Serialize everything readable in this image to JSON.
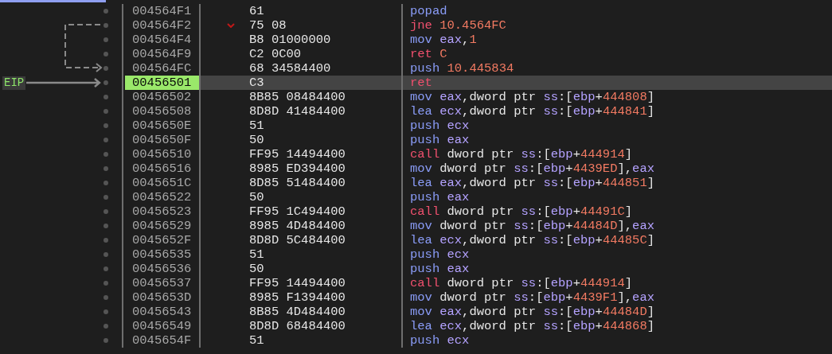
{
  "eip_label": "EIP",
  "rows": [
    {
      "address": "004564F1",
      "bytes": "61",
      "selected": false,
      "branch_marker": false,
      "instruction": {
        "mnemonic": {
          "text": "popad",
          "kind": "normal"
        }
      }
    },
    {
      "address": "004564F2",
      "bytes": "75 08",
      "selected": false,
      "branch_marker": true,
      "instruction": {
        "mnemonic": {
          "text": "jne",
          "kind": "branch"
        },
        "operands": [
          {
            "text": "10.4564FC",
            "kind": "number"
          }
        ]
      }
    },
    {
      "address": "004564F4",
      "bytes": "B8 01000000",
      "selected": false,
      "branch_marker": false,
      "instruction": {
        "mnemonic": {
          "text": "mov",
          "kind": "normal"
        },
        "operands": [
          {
            "text": "eax",
            "kind": "register"
          },
          {
            "text": ",",
            "kind": "plain"
          },
          {
            "text": "1",
            "kind": "number"
          }
        ]
      }
    },
    {
      "address": "004564F9",
      "bytes": "C2 0C00",
      "selected": false,
      "branch_marker": false,
      "instruction": {
        "mnemonic": {
          "text": "ret",
          "kind": "branch"
        },
        "operands": [
          {
            "text": "C",
            "kind": "number"
          }
        ]
      }
    },
    {
      "address": "004564FC",
      "bytes": "68 34584400",
      "selected": false,
      "branch_marker": false,
      "instruction": {
        "mnemonic": {
          "text": "push",
          "kind": "normal"
        },
        "operands": [
          {
            "text": "10.445834",
            "kind": "number"
          }
        ]
      }
    },
    {
      "address": "00456501",
      "bytes": "C3",
      "selected": true,
      "branch_marker": false,
      "instruction": {
        "mnemonic": {
          "text": "ret",
          "kind": "branch"
        }
      }
    },
    {
      "address": "00456502",
      "bytes": "8B85 08484400",
      "selected": false,
      "branch_marker": false,
      "instruction": {
        "mnemonic": {
          "text": "mov",
          "kind": "normal"
        },
        "operands": [
          {
            "text": "eax",
            "kind": "register"
          },
          {
            "text": ",dword ptr ",
            "kind": "plain"
          },
          {
            "text": "ss",
            "kind": "register"
          },
          {
            "text": ":[",
            "kind": "plain"
          },
          {
            "text": "ebp",
            "kind": "register"
          },
          {
            "text": "+",
            "kind": "plain"
          },
          {
            "text": "444808",
            "kind": "number"
          },
          {
            "text": "]",
            "kind": "plain"
          }
        ]
      }
    },
    {
      "address": "00456508",
      "bytes": "8D8D 41484400",
      "selected": false,
      "branch_marker": false,
      "instruction": {
        "mnemonic": {
          "text": "lea",
          "kind": "normal"
        },
        "operands": [
          {
            "text": "ecx",
            "kind": "register"
          },
          {
            "text": ",dword ptr ",
            "kind": "plain"
          },
          {
            "text": "ss",
            "kind": "register"
          },
          {
            "text": ":[",
            "kind": "plain"
          },
          {
            "text": "ebp",
            "kind": "register"
          },
          {
            "text": "+",
            "kind": "plain"
          },
          {
            "text": "444841",
            "kind": "number"
          },
          {
            "text": "]",
            "kind": "plain"
          }
        ]
      }
    },
    {
      "address": "0045650E",
      "bytes": "51",
      "selected": false,
      "branch_marker": false,
      "instruction": {
        "mnemonic": {
          "text": "push",
          "kind": "normal"
        },
        "operands": [
          {
            "text": "ecx",
            "kind": "register"
          }
        ]
      }
    },
    {
      "address": "0045650F",
      "bytes": "50",
      "selected": false,
      "branch_marker": false,
      "instruction": {
        "mnemonic": {
          "text": "push",
          "kind": "normal"
        },
        "operands": [
          {
            "text": "eax",
            "kind": "register"
          }
        ]
      }
    },
    {
      "address": "00456510",
      "bytes": "FF95 14494400",
      "selected": false,
      "branch_marker": false,
      "instruction": {
        "mnemonic": {
          "text": "call",
          "kind": "branch"
        },
        "operands": [
          {
            "text": "dword ptr ",
            "kind": "plain"
          },
          {
            "text": "ss",
            "kind": "register"
          },
          {
            "text": ":[",
            "kind": "plain"
          },
          {
            "text": "ebp",
            "kind": "register"
          },
          {
            "text": "+",
            "kind": "plain"
          },
          {
            "text": "444914",
            "kind": "number"
          },
          {
            "text": "]",
            "kind": "plain"
          }
        ]
      }
    },
    {
      "address": "00456516",
      "bytes": "8985 ED394400",
      "selected": false,
      "branch_marker": false,
      "instruction": {
        "mnemonic": {
          "text": "mov",
          "kind": "normal"
        },
        "operands": [
          {
            "text": "dword ptr ",
            "kind": "plain"
          },
          {
            "text": "ss",
            "kind": "register"
          },
          {
            "text": ":[",
            "kind": "plain"
          },
          {
            "text": "ebp",
            "kind": "register"
          },
          {
            "text": "+",
            "kind": "plain"
          },
          {
            "text": "4439ED",
            "kind": "number"
          },
          {
            "text": "],",
            "kind": "plain"
          },
          {
            "text": "eax",
            "kind": "register"
          }
        ]
      }
    },
    {
      "address": "0045651C",
      "bytes": "8D85 51484400",
      "selected": false,
      "branch_marker": false,
      "instruction": {
        "mnemonic": {
          "text": "lea",
          "kind": "normal"
        },
        "operands": [
          {
            "text": "eax",
            "kind": "register"
          },
          {
            "text": ",dword ptr ",
            "kind": "plain"
          },
          {
            "text": "ss",
            "kind": "register"
          },
          {
            "text": ":[",
            "kind": "plain"
          },
          {
            "text": "ebp",
            "kind": "register"
          },
          {
            "text": "+",
            "kind": "plain"
          },
          {
            "text": "444851",
            "kind": "number"
          },
          {
            "text": "]",
            "kind": "plain"
          }
        ]
      }
    },
    {
      "address": "00456522",
      "bytes": "50",
      "selected": false,
      "branch_marker": false,
      "instruction": {
        "mnemonic": {
          "text": "push",
          "kind": "normal"
        },
        "operands": [
          {
            "text": "eax",
            "kind": "register"
          }
        ]
      }
    },
    {
      "address": "00456523",
      "bytes": "FF95 1C494400",
      "selected": false,
      "branch_marker": false,
      "instruction": {
        "mnemonic": {
          "text": "call",
          "kind": "branch"
        },
        "operands": [
          {
            "text": "dword ptr ",
            "kind": "plain"
          },
          {
            "text": "ss",
            "kind": "register"
          },
          {
            "text": ":[",
            "kind": "plain"
          },
          {
            "text": "ebp",
            "kind": "register"
          },
          {
            "text": "+",
            "kind": "plain"
          },
          {
            "text": "44491C",
            "kind": "number"
          },
          {
            "text": "]",
            "kind": "plain"
          }
        ]
      }
    },
    {
      "address": "00456529",
      "bytes": "8985 4D484400",
      "selected": false,
      "branch_marker": false,
      "instruction": {
        "mnemonic": {
          "text": "mov",
          "kind": "normal"
        },
        "operands": [
          {
            "text": "dword ptr ",
            "kind": "plain"
          },
          {
            "text": "ss",
            "kind": "register"
          },
          {
            "text": ":[",
            "kind": "plain"
          },
          {
            "text": "ebp",
            "kind": "register"
          },
          {
            "text": "+",
            "kind": "plain"
          },
          {
            "text": "44484D",
            "kind": "number"
          },
          {
            "text": "],",
            "kind": "plain"
          },
          {
            "text": "eax",
            "kind": "register"
          }
        ]
      }
    },
    {
      "address": "0045652F",
      "bytes": "8D8D 5C484400",
      "selected": false,
      "branch_marker": false,
      "instruction": {
        "mnemonic": {
          "text": "lea",
          "kind": "normal"
        },
        "operands": [
          {
            "text": "ecx",
            "kind": "register"
          },
          {
            "text": ",dword ptr ",
            "kind": "plain"
          },
          {
            "text": "ss",
            "kind": "register"
          },
          {
            "text": ":[",
            "kind": "plain"
          },
          {
            "text": "ebp",
            "kind": "register"
          },
          {
            "text": "+",
            "kind": "plain"
          },
          {
            "text": "44485C",
            "kind": "number"
          },
          {
            "text": "]",
            "kind": "plain"
          }
        ]
      }
    },
    {
      "address": "00456535",
      "bytes": "51",
      "selected": false,
      "branch_marker": false,
      "instruction": {
        "mnemonic": {
          "text": "push",
          "kind": "normal"
        },
        "operands": [
          {
            "text": "ecx",
            "kind": "register"
          }
        ]
      }
    },
    {
      "address": "00456536",
      "bytes": "50",
      "selected": false,
      "branch_marker": false,
      "instruction": {
        "mnemonic": {
          "text": "push",
          "kind": "normal"
        },
        "operands": [
          {
            "text": "eax",
            "kind": "register"
          }
        ]
      }
    },
    {
      "address": "00456537",
      "bytes": "FF95 14494400",
      "selected": false,
      "branch_marker": false,
      "instruction": {
        "mnemonic": {
          "text": "call",
          "kind": "branch"
        },
        "operands": [
          {
            "text": "dword ptr ",
            "kind": "plain"
          },
          {
            "text": "ss",
            "kind": "register"
          },
          {
            "text": ":[",
            "kind": "plain"
          },
          {
            "text": "ebp",
            "kind": "register"
          },
          {
            "text": "+",
            "kind": "plain"
          },
          {
            "text": "444914",
            "kind": "number"
          },
          {
            "text": "]",
            "kind": "plain"
          }
        ]
      }
    },
    {
      "address": "0045653D",
      "bytes": "8985 F1394400",
      "selected": false,
      "branch_marker": false,
      "instruction": {
        "mnemonic": {
          "text": "mov",
          "kind": "normal"
        },
        "operands": [
          {
            "text": "dword ptr ",
            "kind": "plain"
          },
          {
            "text": "ss",
            "kind": "register"
          },
          {
            "text": ":[",
            "kind": "plain"
          },
          {
            "text": "ebp",
            "kind": "register"
          },
          {
            "text": "+",
            "kind": "plain"
          },
          {
            "text": "4439F1",
            "kind": "number"
          },
          {
            "text": "],",
            "kind": "plain"
          },
          {
            "text": "eax",
            "kind": "register"
          }
        ]
      }
    },
    {
      "address": "00456543",
      "bytes": "8B85 4D484400",
      "selected": false,
      "branch_marker": false,
      "instruction": {
        "mnemonic": {
          "text": "mov",
          "kind": "normal"
        },
        "operands": [
          {
            "text": "eax",
            "kind": "register"
          },
          {
            "text": ",dword ptr ",
            "kind": "plain"
          },
          {
            "text": "ss",
            "kind": "register"
          },
          {
            "text": ":[",
            "kind": "plain"
          },
          {
            "text": "ebp",
            "kind": "register"
          },
          {
            "text": "+",
            "kind": "plain"
          },
          {
            "text": "44484D",
            "kind": "number"
          },
          {
            "text": "]",
            "kind": "plain"
          }
        ]
      }
    },
    {
      "address": "00456549",
      "bytes": "8D8D 68484400",
      "selected": false,
      "branch_marker": false,
      "instruction": {
        "mnemonic": {
          "text": "lea",
          "kind": "normal"
        },
        "operands": [
          {
            "text": "ecx",
            "kind": "register"
          },
          {
            "text": ",dword ptr ",
            "kind": "plain"
          },
          {
            "text": "ss",
            "kind": "register"
          },
          {
            "text": ":[",
            "kind": "plain"
          },
          {
            "text": "ebp",
            "kind": "register"
          },
          {
            "text": "+",
            "kind": "plain"
          },
          {
            "text": "444868",
            "kind": "number"
          },
          {
            "text": "]",
            "kind": "plain"
          }
        ]
      }
    },
    {
      "address": "0045654F",
      "bytes": "51",
      "selected": false,
      "branch_marker": false,
      "instruction": {
        "mnemonic": {
          "text": "push",
          "kind": "normal"
        },
        "operands": [
          {
            "text": "ecx",
            "kind": "register"
          }
        ]
      }
    }
  ]
}
